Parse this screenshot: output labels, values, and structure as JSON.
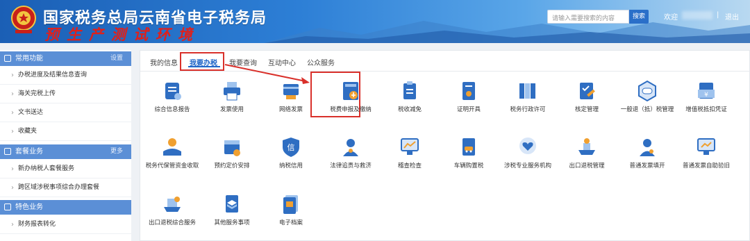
{
  "header": {
    "title": "国家税务总局云南省电子税务局",
    "subtitle": "预生产测试环境",
    "search_placeholder": "请输入需要搜索的内容",
    "search_button": "搜索",
    "welcome": "欢迎",
    "separator": "|",
    "logout": "退出"
  },
  "sidebar": {
    "sections": [
      {
        "title": "常用功能",
        "link": "设置",
        "items": [
          "办税进度及结果信息查询",
          "海关完税上传",
          "文书送达",
          "收藏夹"
        ]
      },
      {
        "title": "套餐业务",
        "link": "更多",
        "items": [
          "新办纳税人套餐服务",
          "跨区域涉税事项综合办理套餐"
        ]
      },
      {
        "title": "特色业务",
        "link": "",
        "items": [
          "财务报表转化"
        ]
      }
    ]
  },
  "tabs": [
    "我的信息",
    "我要办税",
    "我要查询",
    "互动中心",
    "公众服务"
  ],
  "active_tab": "我要办税",
  "functions": [
    {
      "label": "综合信息报告",
      "icon": "report-icon"
    },
    {
      "label": "发票使用",
      "icon": "printer-icon"
    },
    {
      "label": "网络发票",
      "icon": "card-icon"
    },
    {
      "label": "税费申报及缴纳",
      "icon": "declare-icon"
    },
    {
      "label": "税收减免",
      "icon": "clipboard-icon"
    },
    {
      "label": "证明开具",
      "icon": "certificate-icon"
    },
    {
      "label": "税务行政许可",
      "icon": "binders-icon"
    },
    {
      "label": "核定管理",
      "icon": "checklist-icon"
    },
    {
      "label": "一般退（抵）税管理",
      "icon": "refund-icon"
    },
    {
      "label": "增值税抵扣凭证",
      "icon": "voucher-icon"
    },
    {
      "label": "税务代保管资金收取",
      "icon": "money-hand-icon"
    },
    {
      "label": "预约定价安排",
      "icon": "calendar-icon"
    },
    {
      "label": "纳税信用",
      "icon": "shield-icon"
    },
    {
      "label": "法律追责与救济",
      "icon": "law-person-icon"
    },
    {
      "label": "稽查检查",
      "icon": "monitor-chart-icon"
    },
    {
      "label": "车辆购置税",
      "icon": "car-doc-icon"
    },
    {
      "label": "涉税专业服务机构",
      "icon": "heart-hand-icon"
    },
    {
      "label": "出口退税管理",
      "icon": "ship-icon"
    },
    {
      "label": "普通发票填开",
      "icon": "person-icon"
    },
    {
      "label": "普通发票自助验旧",
      "icon": "monitor-icon"
    },
    {
      "label": "出口退税综合服务",
      "icon": "ship-service-icon"
    },
    {
      "label": "其他服务事项",
      "icon": "box-icon"
    },
    {
      "label": "电子档案",
      "icon": "archive-icon"
    }
  ],
  "colors": {
    "header_blue": "#1b5fb5",
    "sidebar_head": "#5b8fd6",
    "accent": "#1f66c8",
    "highlight_red": "#d9302a",
    "icon_blue": "#2f6ec2",
    "icon_orange": "#f0a030"
  }
}
